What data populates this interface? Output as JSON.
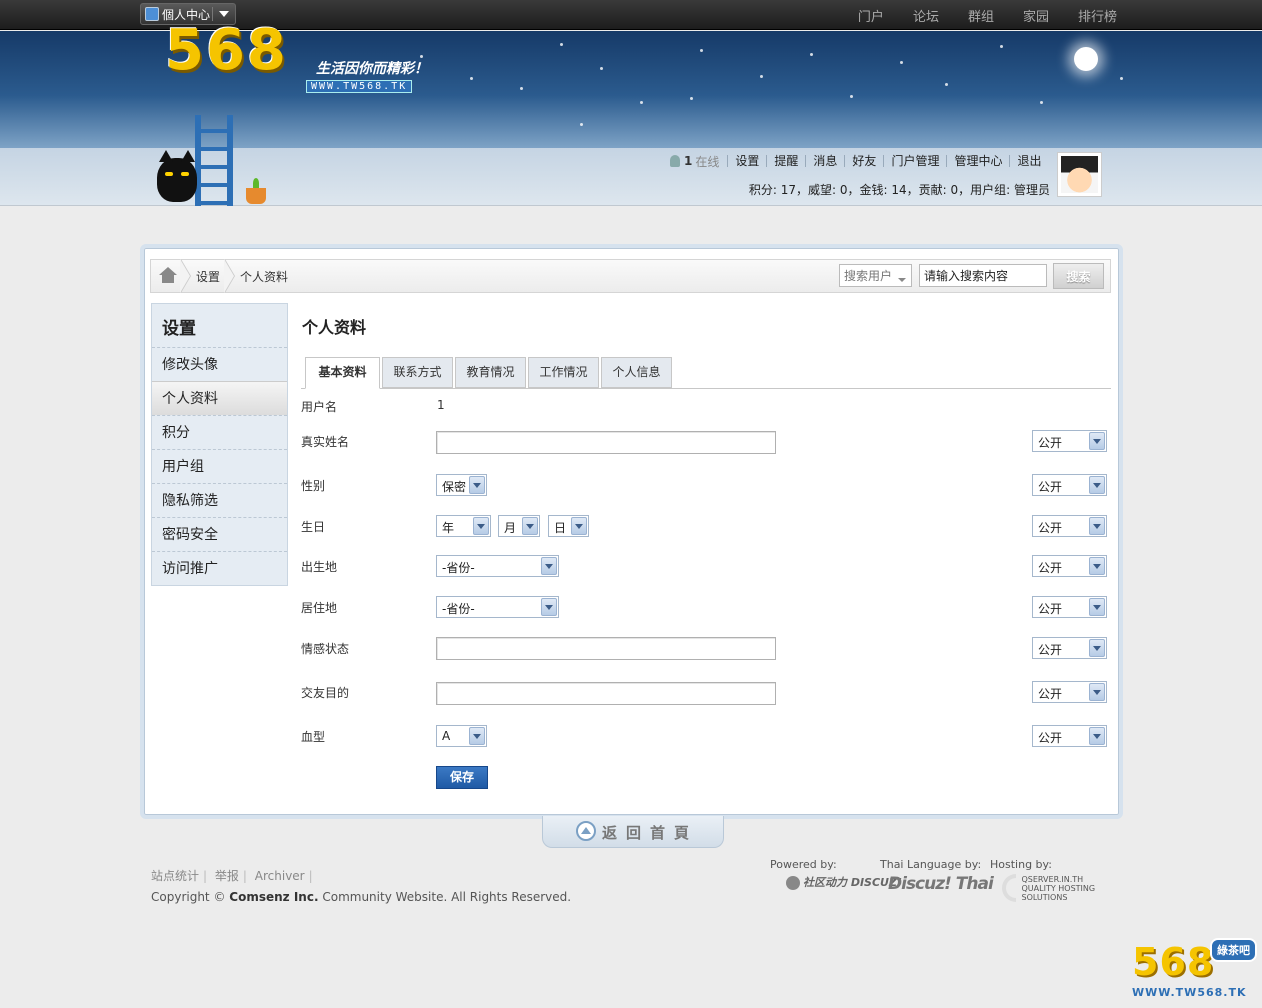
{
  "topbar": {
    "user_center": "個人中心",
    "nav": [
      "门户",
      "论坛",
      "群组",
      "家园",
      "排行榜"
    ]
  },
  "header": {
    "logo_text": "568",
    "slogan": "生活因你而精彩！",
    "logo_url": "WWW.TW568.TK"
  },
  "user": {
    "online_count": "1",
    "online_label": "在线",
    "menu": [
      "设置",
      "提醒",
      "消息",
      "好友",
      "门户管理",
      "管理中心",
      "退出"
    ],
    "stats": "积分: 17，威望: 0，金钱: 14，贡献: 0，用户组: 管理员"
  },
  "breadcrumb": {
    "items": [
      "设置",
      "个人资料"
    ]
  },
  "search": {
    "type": "搜索用户",
    "value": "请输入搜索内容",
    "button": "搜索"
  },
  "sidebar": {
    "title": "设置",
    "items": [
      {
        "label": "修改头像",
        "active": false
      },
      {
        "label": "个人资料",
        "active": true
      },
      {
        "label": "积分",
        "active": false
      },
      {
        "label": "用户组",
        "active": false
      },
      {
        "label": "隐私筛选",
        "active": false
      },
      {
        "label": "密码安全",
        "active": false
      },
      {
        "label": "访问推广",
        "active": false
      }
    ]
  },
  "content": {
    "title": "个人资料",
    "tabs": [
      "基本资料",
      "联系方式",
      "教育情况",
      "工作情况",
      "个人信息"
    ],
    "active_tab": "基本资料",
    "form": {
      "username_label": "用户名",
      "username_value": "1",
      "realname_label": "真实姓名",
      "gender_label": "性别",
      "gender_value": "保密",
      "birthday_label": "生日",
      "birth_year": "年",
      "birth_month": "月",
      "birth_day": "日",
      "birthplace_label": "出生地",
      "birthplace_value": "-省份-",
      "residence_label": "居住地",
      "residence_value": "-省份-",
      "affective_label": "情感状态",
      "purpose_label": "交友目的",
      "bloodtype_label": "血型",
      "bloodtype_value": "A",
      "privacy_value": "公开",
      "save": "保存"
    }
  },
  "backhome": "返回首頁",
  "footer": {
    "links": [
      "站点统计",
      "举报",
      "Archiver"
    ],
    "copyright_prefix": "Copyright ©",
    "copyright_company": "Comsenz Inc.",
    "copyright_suffix": "Community Website. All Rights Reserved.",
    "powered_by": "Powered by:",
    "powered_logo": "社区动力 DISCUZ!",
    "thai_language_by": "Thai Language by:",
    "thai_logo": "Discuz! Thai",
    "hosting_by": "Hosting by:",
    "hosting_logo_1": "QSERVER.IN.TH",
    "hosting_logo_2": "QUALITY HOSTING",
    "hosting_logo_3": "SOLUTIONS"
  },
  "watermark": {
    "number": "568",
    "badge": "綠茶吧",
    "url": "WWW.TW568.TK"
  }
}
